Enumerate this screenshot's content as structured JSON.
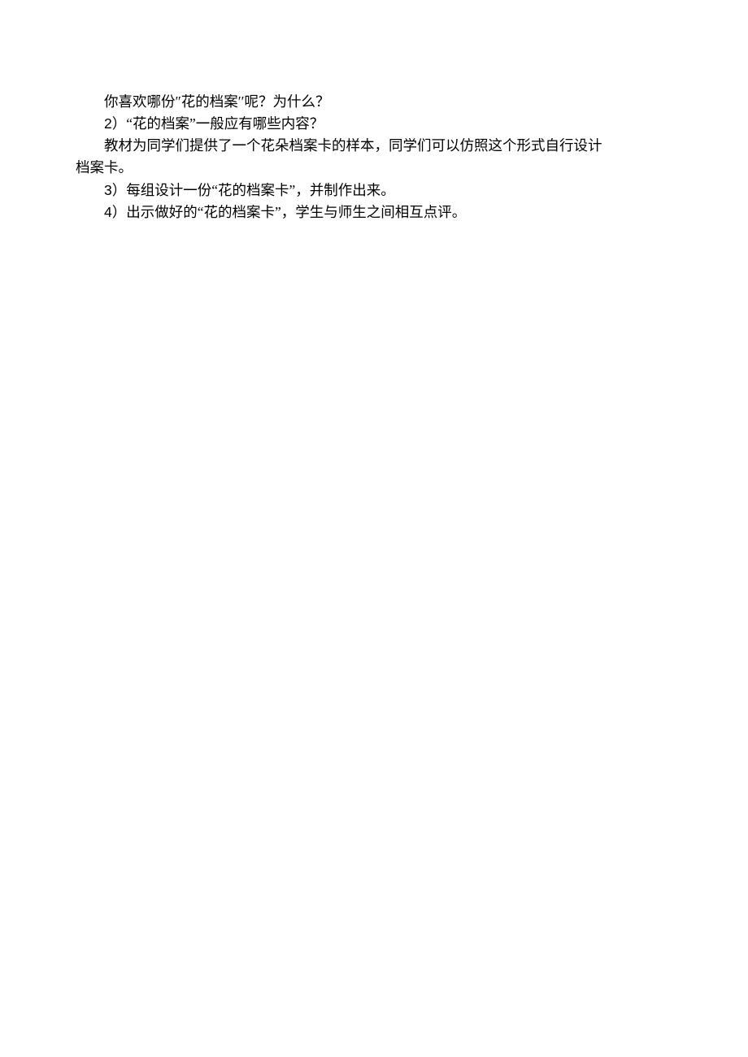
{
  "lines": {
    "l1": "你喜欢哪份″花的档案′′呢？为什么？",
    "l2_prefix": "2",
    "l2": "）“花的档案”一般应有哪些内容？",
    "l3": "教材为同学们提供了一个花朵档案卡的样本，同学们可以仿照这个形式自行设计",
    "l4": "档案卡。",
    "l5_prefix": "3",
    "l5": "）每组设计一份“花的档案卡”，并制作出来。",
    "l6_prefix": "4",
    "l6": "）出示做好的“花的档案卡”，学生与师生之间相互点评。"
  }
}
